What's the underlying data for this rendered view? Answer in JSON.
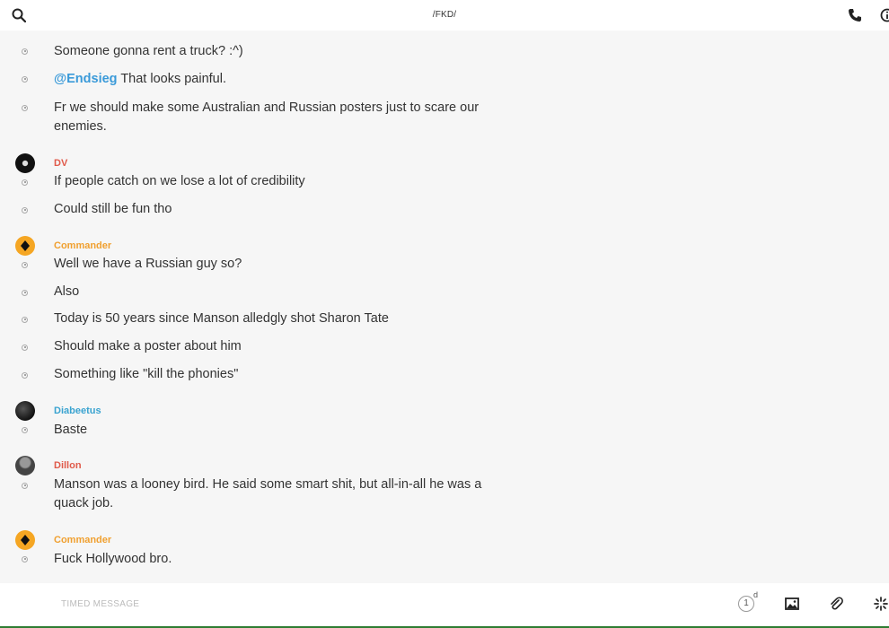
{
  "header": {
    "title": "/FKD/",
    "icons": {
      "search": "search-icon",
      "call": "phone-icon",
      "info": "info-icon"
    }
  },
  "colors": {
    "mention": "#3a9ad9",
    "dv": "#e05a4a",
    "commander": "#f0a030",
    "diabeetus": "#3aa3d0",
    "dillon": "#e05a4a"
  },
  "messages": {
    "m0": {
      "text": "Someone gonna rent a truck? :^)"
    },
    "m1": {
      "mention": "@Endsieg",
      "text": " That looks painful."
    },
    "m2": {
      "text": "Fr we should make some Australian and Russian posters just to scare our enemies."
    },
    "g1": {
      "author": "DV"
    },
    "m3": {
      "text": "If people catch on we lose a lot of credibility"
    },
    "m4": {
      "text": "Could still be fun tho"
    },
    "g2": {
      "author": "Commander"
    },
    "m5": {
      "text": "Well we have a Russian guy so?"
    },
    "m6": {
      "text": "Also"
    },
    "m7": {
      "text": "Today is 50 years since Manson alledgly shot Sharon Tate"
    },
    "m8": {
      "text": "Should make a poster about him"
    },
    "m9": {
      "text": "Something like \"kill the phonies\""
    },
    "g3": {
      "author": "Diabeetus"
    },
    "m10": {
      "text": "Baste"
    },
    "g4": {
      "author": "Dillon"
    },
    "m11": {
      "text": "Manson was a looney bird. He said some smart shit, but all-in-all he was a quack job."
    },
    "g5": {
      "author": "Commander"
    },
    "m12": {
      "text": "Fuck Hollywood bro."
    }
  },
  "composer": {
    "placeholder": "TIMED MESSAGE",
    "timer_value": "1",
    "timer_unit": "d",
    "icons": {
      "image": "image-icon",
      "attach": "paperclip-icon",
      "gif": "sparkle-icon"
    }
  }
}
